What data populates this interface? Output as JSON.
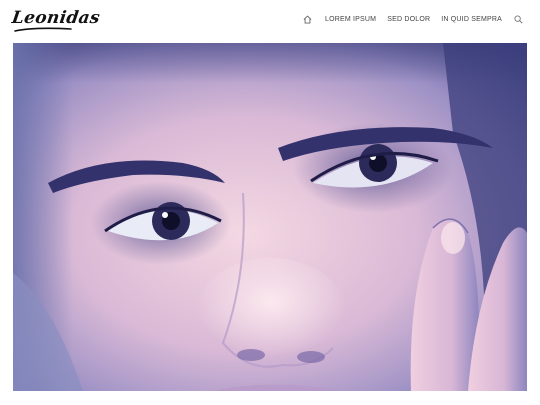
{
  "header": {
    "logo_text": "Leonidas"
  },
  "nav": {
    "home_icon": "home-icon",
    "items": [
      {
        "label": "LOREM IPSUM"
      },
      {
        "label": "SED DOLOR"
      },
      {
        "label": "IN QUID SEMPRA"
      }
    ],
    "search_icon": "search-icon"
  },
  "hero": {
    "image": "close-up duotone portrait of a man's face with hand on cheek",
    "colors": {
      "shadow": "#2a2c66",
      "highlight": "#f6dbe4"
    }
  }
}
